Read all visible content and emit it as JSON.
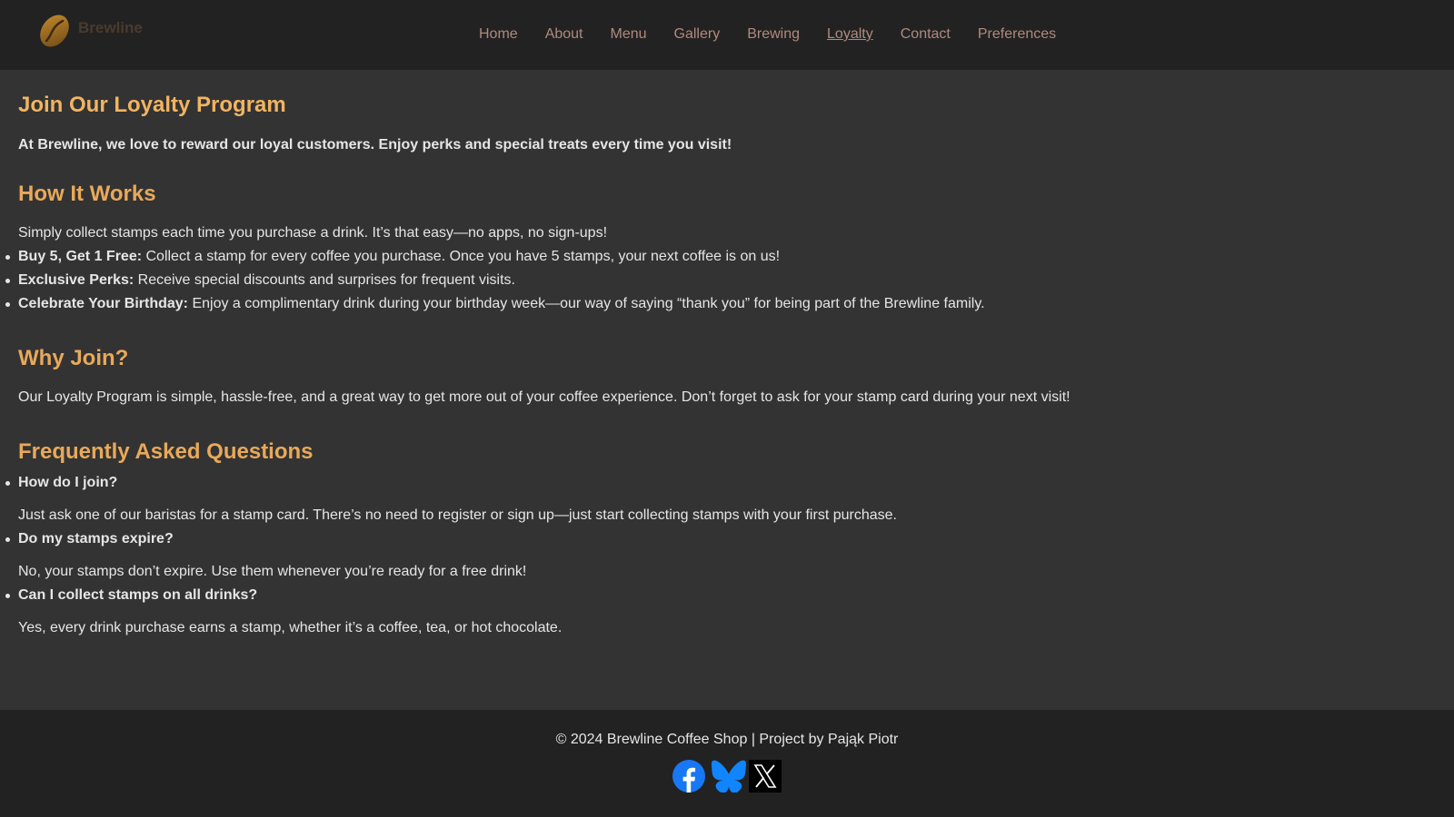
{
  "brand": {
    "name": "Brewline"
  },
  "nav": {
    "items": [
      {
        "label": "Home"
      },
      {
        "label": "About"
      },
      {
        "label": "Menu"
      },
      {
        "label": "Gallery"
      },
      {
        "label": "Brewing"
      },
      {
        "label": "Loyalty",
        "active": true
      },
      {
        "label": "Contact"
      },
      {
        "label": "Preferences"
      }
    ]
  },
  "page": {
    "title": "Join Our Loyalty Program",
    "intro": "At Brewline, we love to reward our loyal customers. Enjoy perks and special treats every time you visit!",
    "how": {
      "heading": "How It Works",
      "text": "Simply collect stamps each time you purchase a drink. It’s that easy—no apps, no sign-ups!",
      "perks": [
        {
          "label": "Buy 5, Get 1 Free:",
          "text": " Collect a stamp for every coffee you purchase. Once you have 5 stamps, your next coffee is on us!"
        },
        {
          "label": "Exclusive Perks:",
          "text": " Receive special discounts and surprises for frequent visits."
        },
        {
          "label": "Celebrate Your Birthday:",
          "text": " Enjoy a complimentary drink during your birthday week—our way of saying “thank you” for being part of the Brewline family."
        }
      ]
    },
    "why": {
      "heading": "Why Join?",
      "text": "Our Loyalty Program is simple, hassle-free, and a great way to get more out of your coffee experience. Don’t forget to ask for your stamp card during your next visit!"
    },
    "faq": {
      "heading": "Frequently Asked Questions",
      "items": [
        {
          "q": "How do I join?",
          "a": "Just ask one of our baristas for a stamp card. There’s no need to register or sign up—just start collecting stamps with your first purchase."
        },
        {
          "q": "Do my stamps expire?",
          "a": "No, your stamps don’t expire. Use them whenever you’re ready for a free drink!"
        },
        {
          "q": "Can I collect stamps on all drinks?",
          "a": "Yes, every drink purchase earns a stamp, whether it’s a coffee, tea, or hot chocolate."
        }
      ]
    }
  },
  "footer": {
    "copyright": "© 2024 Brewline Coffee Shop | Project by Pająk Piotr",
    "socials": [
      {
        "icon": "facebook-icon",
        "color": "#1877f2"
      },
      {
        "icon": "bluesky-icon",
        "color": "#1185fe"
      },
      {
        "icon": "x-icon",
        "color": "#000000"
      }
    ]
  },
  "colors": {
    "background": "#333333",
    "header_bg": "#222222",
    "heading": "#f1b462",
    "nav_link": "#b08a7e",
    "text": "#e6e6e6"
  }
}
